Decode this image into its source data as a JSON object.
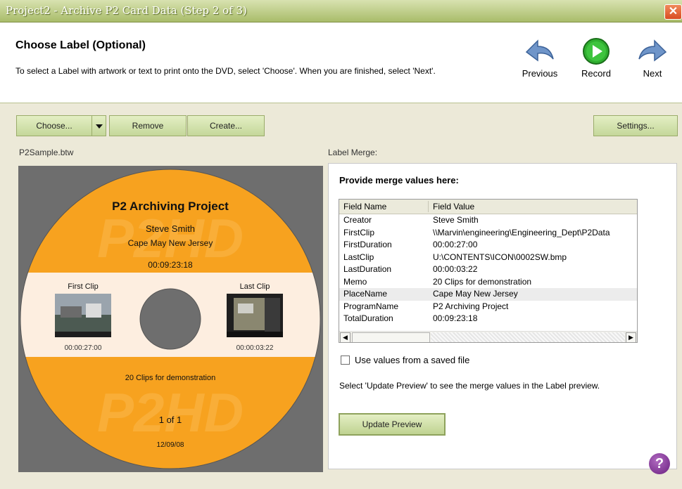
{
  "window": {
    "title": "Project2 - Archive P2 Card Data (Step 2 of 3)",
    "close_glyph": "✕"
  },
  "header": {
    "title": "Choose Label (Optional)",
    "description": "To select a Label with artwork or text to print onto the DVD, select 'Choose'.  When you are finished, select 'Next'.",
    "nav": {
      "previous": "Previous",
      "record": "Record",
      "next": "Next"
    }
  },
  "toolbar": {
    "choose": "Choose...",
    "remove": "Remove",
    "create": "Create...",
    "settings": "Settings..."
  },
  "file_name": "P2Sample.btw",
  "merge_label": "Label Merge:",
  "disc": {
    "title": "P2 Archiving Project",
    "creator": "Steve Smith",
    "place": "Cape May New Jersey",
    "total_duration": "00:09:23:18",
    "first_clip_label": "First Clip",
    "last_clip_label": "Last Clip",
    "first_duration": "00:00:27:00",
    "last_duration": "00:00:03:22",
    "memo": "20 Clips for demonstration",
    "page": "1 of 1",
    "date": "12/09/08",
    "watermark": "P2HD",
    "colors": {
      "orange": "#f7a21f",
      "cream": "#fdeee0",
      "hub": "#6e6e6e"
    }
  },
  "merge": {
    "heading": "Provide merge values here:",
    "columns": [
      "Field Name",
      "Field Value"
    ],
    "rows": [
      {
        "name": "Creator",
        "value": "Steve Smith"
      },
      {
        "name": "FirstClip",
        "value": "\\\\Marvin\\engineering\\Engineering_Dept\\P2Data"
      },
      {
        "name": "FirstDuration",
        "value": "00:00:27:00"
      },
      {
        "name": "LastClip",
        "value": "U:\\CONTENTS\\ICON\\0002SW.bmp"
      },
      {
        "name": "LastDuration",
        "value": "00:00:03:22"
      },
      {
        "name": "Memo",
        "value": "20 Clips for demonstration"
      },
      {
        "name": "PlaceName",
        "value": "Cape May New Jersey"
      },
      {
        "name": "ProgramName",
        "value": "P2 Archiving Project"
      },
      {
        "name": "TotalDuration",
        "value": "00:09:23:18"
      }
    ],
    "selected_row": "PlaceName",
    "checkbox_label": "Use values from a saved file",
    "checkbox_checked": false,
    "hint": "Select 'Update Preview' to see the merge values in the Label preview.",
    "update_button": "Update Preview"
  },
  "help_glyph": "?"
}
